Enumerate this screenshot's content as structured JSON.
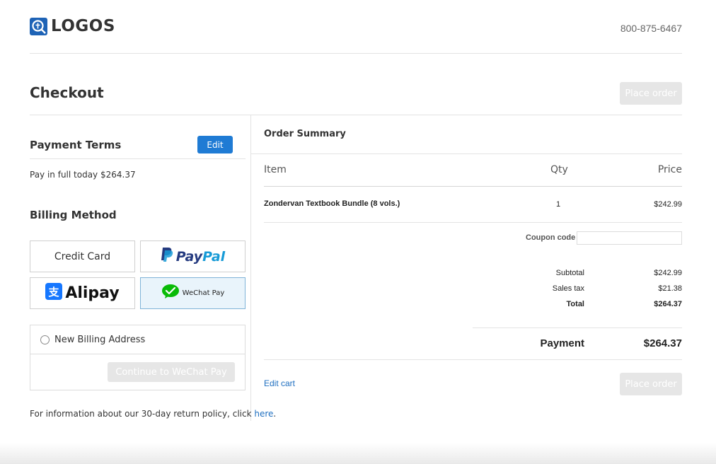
{
  "header": {
    "logo_text": "LOGOS",
    "phone": "800-875-6467"
  },
  "page": {
    "title": "Checkout",
    "place_order_label": "Place order"
  },
  "payment_terms": {
    "title": "Payment Terms",
    "edit_label": "Edit",
    "description": "Pay in full today $264.37"
  },
  "billing": {
    "title": "Billing Method",
    "methods": {
      "credit_card": "Credit Card",
      "paypal_a": "Pay",
      "paypal_b": "Pal",
      "alipay": "Alipay",
      "wechat": "WeChat Pay"
    },
    "selected": "WeChat Pay",
    "new_address_label": "New Billing Address",
    "continue_label": "Continue to WeChat Pay"
  },
  "return_policy": {
    "text": "For information about our 30-day return policy, click ",
    "link": "here",
    "end": "."
  },
  "order_summary": {
    "title": "Order Summary",
    "columns": {
      "item": "Item",
      "qty": "Qty",
      "price": "Price"
    },
    "items": [
      {
        "name": "Zondervan Textbook Bundle (8 vols.)",
        "qty": "1",
        "price": "$242.99"
      }
    ],
    "coupon_label": "Coupon code",
    "coupon_value": "",
    "subtotal_label": "Subtotal",
    "subtotal": "$242.99",
    "tax_label": "Sales tax",
    "tax": "$21.38",
    "total_label": "Total",
    "total": "$264.37",
    "payment_label": "Payment",
    "payment": "$264.37",
    "edit_cart_label": "Edit cart"
  },
  "colors": {
    "accent": "#1f7bd4",
    "link": "#1e6fc0",
    "selected_bg": "#e9f4fb"
  }
}
